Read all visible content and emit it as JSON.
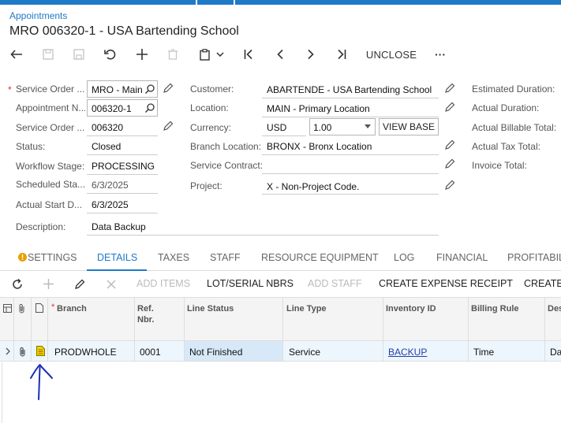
{
  "breadcrumb": "Appointments",
  "title": "MRO 006320-1 - USA Bartending School",
  "toolbar": {
    "unclose_label": "UNCLOSE",
    "more_label": "···"
  },
  "form": {
    "left": {
      "service_order_type": {
        "label": "Service Order ...",
        "value": "MRO - Main"
      },
      "appointment_nbr": {
        "label": "Appointment N...",
        "value": "006320-1"
      },
      "service_order_nbr": {
        "label": "Service Order ...",
        "value": "006320"
      },
      "status": {
        "label": "Status:",
        "value": "Closed"
      },
      "workflow_stage": {
        "label": "Workflow Stage:",
        "value": "PROCESSING"
      },
      "scheduled_start": {
        "label": "Scheduled Sta...",
        "value": "6/3/2025"
      },
      "actual_start": {
        "label": "Actual Start D...",
        "value": "6/3/2025"
      },
      "description": {
        "label": "Description:",
        "value": "Data Backup"
      }
    },
    "middle": {
      "customer": {
        "label": "Customer:",
        "value": "ABARTENDE - USA Bartending School"
      },
      "location": {
        "label": "Location:",
        "value": "MAIN - Primary Location"
      },
      "currency": {
        "label": "Currency:",
        "value": "USD",
        "rate": "1.00",
        "view_base_label": "VIEW BASE"
      },
      "branch_location": {
        "label": "Branch Location:",
        "value": "BRONX - Bronx Location"
      },
      "service_contract": {
        "label": "Service Contract:",
        "value": ""
      },
      "project": {
        "label": "Project:",
        "value": "X - Non-Project Code."
      }
    },
    "right": {
      "estimated_duration": "Estimated Duration:",
      "actual_duration": "Actual Duration:",
      "actual_billable_total": "Actual Billable Total:",
      "actual_tax_total": "Actual Tax Total:",
      "invoice_total": "Invoice Total:"
    }
  },
  "tabs": [
    "SETTINGS",
    "DETAILS",
    "TAXES",
    "STAFF",
    "RESOURCE EQUIPMENT",
    "LOG",
    "FINANCIAL",
    "PROFITABIL"
  ],
  "grid_toolbar": {
    "add_items": "ADD ITEMS",
    "lot_serial": "LOT/SERIAL NBRS",
    "add_staff": "ADD STAFF",
    "create_expense": "CREATE EXPENSE RECEIPT",
    "create_more": "CREATE"
  },
  "grid": {
    "headers": {
      "branch": "Branch",
      "ref_nbr_1": "Ref.",
      "ref_nbr_2": "Nbr.",
      "line_status": "Line Status",
      "line_type": "Line Type",
      "inventory_id": "Inventory ID",
      "billing_rule": "Billing Rule",
      "description": "Des"
    },
    "rows": [
      {
        "branch": "PRODWHOLE",
        "ref_nbr": "0001",
        "line_status": "Not Finished",
        "line_type": "Service",
        "inventory_id": "BACKUP",
        "billing_rule": "Time",
        "description": "Da"
      }
    ]
  },
  "colors": {
    "accent": "#1f7ac7",
    "annotation": "#1a2fb8",
    "doc_icon": "#c9a800"
  }
}
